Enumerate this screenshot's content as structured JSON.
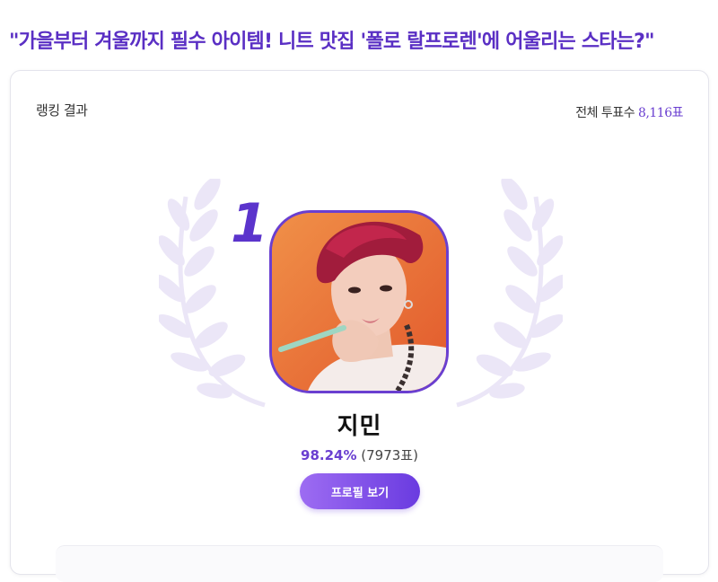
{
  "header": {
    "title": "\"가을부터 겨울까지 필수 아이템! 니트 맛집 '폴로 랄프로렌'에 어울리는 스타는?\""
  },
  "result": {
    "ranking_label": "랭킹 결과",
    "total_label": "전체 투표수",
    "total_votes": "8,116표"
  },
  "winner": {
    "rank": "1",
    "name": "지민",
    "percent": "98.24%",
    "votes": "(7973표)",
    "profile_button_label": "프로필 보기"
  },
  "colors": {
    "accent": "#6a3fd0",
    "title": "#5a2fc4",
    "wreath": "#ebe6f7"
  }
}
